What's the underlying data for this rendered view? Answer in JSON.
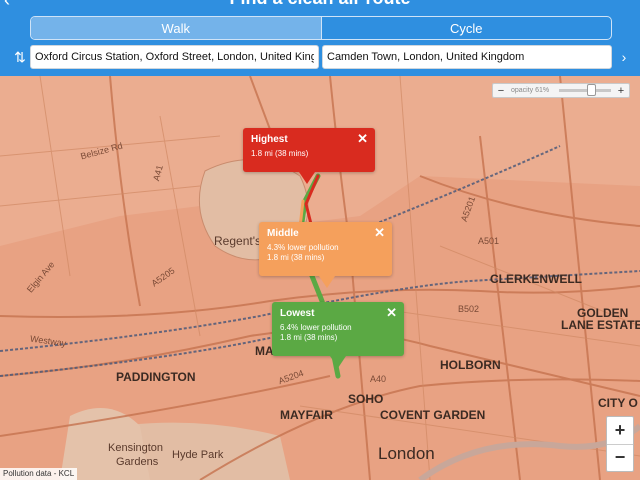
{
  "header": {
    "title": "Find a clean air route",
    "modes": [
      "Walk",
      "Cycle"
    ],
    "active_mode": "Walk"
  },
  "inputs": {
    "from": "Oxford Circus Station, Oxford Street, London, United Kingdom",
    "to": "Camden Town, London, United Kingdom"
  },
  "opacity": {
    "label": "opacity 61%",
    "value": 0.61,
    "minus": "−",
    "plus": "+"
  },
  "routes": [
    {
      "name": "Highest",
      "detail": "",
      "distance": "1.8 mi (38 mins)",
      "color": "#d92b1f"
    },
    {
      "name": "Middle",
      "detail": "4.3% lower pollution",
      "distance": "1.8 mi (38 mins)",
      "color": "#f5a05c"
    },
    {
      "name": "Lowest",
      "detail": "6.4% lower pollution",
      "distance": "1.8 mi (38 mins)",
      "color": "#5ba944"
    }
  ],
  "close_symbol": "✕",
  "map_labels": {
    "clerkenwell": "CLERKENWELL",
    "golden": "GOLDEN",
    "lane_estate": "LANE ESTATE",
    "paddington": "PADDINGTON",
    "holborn": "HOLBORN",
    "soho": "SOHO",
    "covent_garden": "COVENT GARDEN",
    "mayfair": "MAYFAIR",
    "city": "CITY O",
    "london": "London",
    "kensington": "Kensington",
    "gardens": "Gardens",
    "hyde_park": "Hyde Park",
    "regents": "Regent's",
    "ma": "MA",
    "westway": "Westway",
    "elgin_ave": "Elgin Ave",
    "belsize": "Belsize Rd",
    "a5205": "A5205",
    "a5204": "A5204",
    "a501": "A501",
    "a5201": "A5201",
    "a40": "A40",
    "b502": "B502",
    "a41": "A41"
  },
  "zoom": {
    "in": "+",
    "out": "−"
  },
  "attribution": "Pollution data - KCL",
  "colors": {
    "header": "#2f8fe0",
    "pollution": "#e8a283",
    "park": "#e2bda4"
  }
}
